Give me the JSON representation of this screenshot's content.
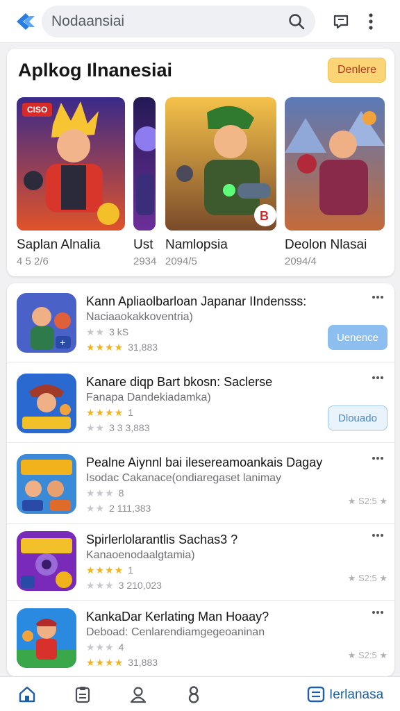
{
  "top_bar": {
    "search_text": "Nodaansiai",
    "icons": [
      "app-logo-icon",
      "search-icon",
      "chat-icon",
      "kebab-menu-icon"
    ]
  },
  "featured": {
    "title": "Aplkog Ilnanesiai",
    "button_label": "Denlere",
    "tiles": [
      {
        "name": "Saplan Alnalia",
        "sub": "4 5 2/6",
        "badge": "CISO"
      },
      {
        "name": "Ust",
        "sub": "2934"
      },
      {
        "name": "Namlopsia",
        "sub": "2094/5"
      },
      {
        "name": "Deolon Nlasai",
        "sub": "2094/4"
      }
    ]
  },
  "apps": [
    {
      "title": "Kann Apliaolbarloan Japanar    IIndensss:",
      "sub": "Naciaaokakkoventria)",
      "line1_text": "3 kS",
      "line1_stars": 2,
      "line2_text": "31,883",
      "line2_stars": 3,
      "action": "Uenence",
      "action_style": "filled",
      "side": ""
    },
    {
      "title": "Kanare diqp Bart bkosn: Saclerse",
      "sub": "Fanapa Dandekiadamka)",
      "line1_text": "1",
      "line1_stars": 4,
      "line2_text": "3 3 3,883",
      "line2_stars": 0,
      "action": "Dlouado",
      "action_style": "outline",
      "side": ""
    },
    {
      "title": "Pealne Aiynnl bai ilesereamoankais Dagay",
      "sub": "Isodac Cakanace(ondiaregaset lanimay",
      "line1_text": "8",
      "line1_stars": 0,
      "line2_text": "2 111,383",
      "line2_stars": 0,
      "action": "",
      "action_style": "",
      "side": "★ S2:5 ★"
    },
    {
      "title": "Spirlerlolarantlis Sachas3 ?",
      "sub": "Kanaoenodaalgtamia)",
      "line1_text": "1",
      "line1_stars": 4,
      "line2_text": "3 210,023",
      "line2_stars": 0,
      "action": "",
      "action_style": "",
      "side": "★ S2:5 ★"
    },
    {
      "title": "KankaDar Kerlating Man Hoaay?",
      "sub": "Deboad: Cenlarendiamgegeoaninan",
      "line1_text": "4",
      "line1_stars": 2,
      "line2_text": "31,883",
      "line2_stars": 3,
      "action": "",
      "action_style": "",
      "side": "★ S2:5 ★"
    }
  ],
  "bottom_nav": {
    "items": [
      "home-icon",
      "clipboard-icon",
      "person-icon",
      "eight-icon",
      "library-icon"
    ],
    "label": "Ierlanasa"
  },
  "colors": {
    "accent": "#1f5fa8",
    "star": "#f2b21c",
    "yellow_button": "#fbd475",
    "blue_button": "#8cbef0"
  }
}
